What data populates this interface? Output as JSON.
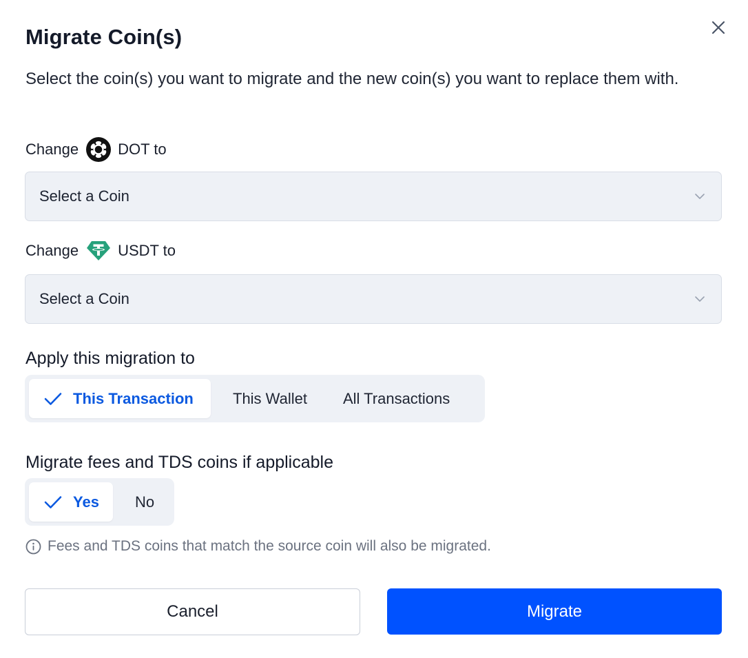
{
  "dialog": {
    "title": "Migrate Coin(s)",
    "subtitle": "Select the coin(s) you want to migrate and the new coin(s) you want to replace them with.",
    "close_icon": "close-icon"
  },
  "changes": [
    {
      "prefix": "Change",
      "coin": "DOT to",
      "icon": "polkadot-icon",
      "select_placeholder": "Select a Coin"
    },
    {
      "prefix": "Change",
      "coin": "USDT to",
      "icon": "tether-icon",
      "select_placeholder": "Select a Coin"
    }
  ],
  "apply_scope": {
    "label": "Apply this migration to",
    "options": [
      "This Transaction",
      "This Wallet",
      "All Transactions"
    ],
    "selected": "This Transaction"
  },
  "migrate_fees": {
    "label": "Migrate fees and TDS coins if applicable",
    "options": [
      "Yes",
      "No"
    ],
    "selected": "Yes",
    "note": "Fees and TDS coins that match the source coin will also be migrated."
  },
  "actions": {
    "cancel_label": "Cancel",
    "migrate_label": "Migrate"
  },
  "colors": {
    "primary": "#0052ff",
    "selected_text": "#0b59e0",
    "tether_green": "#26a17b",
    "field_bg": "#eef1f6"
  }
}
